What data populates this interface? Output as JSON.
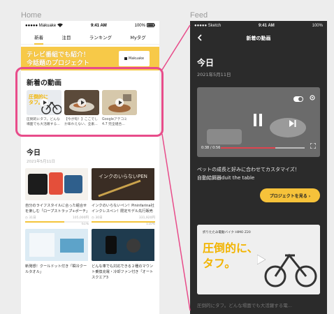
{
  "labels": {
    "home": "Home",
    "feed": "Feed"
  },
  "home": {
    "status": {
      "carrier": "●●●●● Makuake",
      "time": "9:41 AM",
      "battery": "100%"
    },
    "tabs": [
      "新着",
      "注目",
      "ランキング",
      "Myタグ"
    ],
    "banner": {
      "line1": "テレビ番組でも紹介！",
      "line2": "今話題のプロジェクト",
      "card": "Makuake"
    },
    "new_videos": {
      "title": "新着の動画",
      "items": [
        {
          "caption1": "圧倒的にタフ。どんな",
          "caption2": "場面でも大活躍する..."
        },
        {
          "caption1": "【今が旬！】ここでし",
          "caption2": "か味わえない、全素..."
        },
        {
          "caption1": "Googleアテコミ",
          "caption2": "4.7 完全組合..."
        }
      ]
    },
    "today": {
      "title": "今日",
      "date": "2021年5月11日",
      "cards": [
        {
          "title": "自分のライフスタイルに合った組合せを楽しむ「ロープストラップ+ポーチ」",
          "meta_left": "◷ 31日",
          "meta_right": "105,000円",
          "pct_label": "61%",
          "fill": 0.61
        },
        {
          "title": "インクのいらないペン！Pininfarina社インクレスペン！限定モデル先行販売",
          "meta_left": "◷ 30日",
          "meta_right": "331,920円",
          "pct_label": "110%",
          "fill": 1.0
        },
        {
          "title": "新発想！クールドット付き「瞬冷クールタオル」",
          "meta_left": "",
          "meta_right": "",
          "pct_label": "",
          "fill": 0
        },
        {
          "title": "どんな車でも対応できる２種のマウント乗換充電・冷却ファン付き「オートスクエア3",
          "meta_left": "",
          "meta_right": "",
          "pct_label": "",
          "fill": 0
        }
      ]
    }
  },
  "feed": {
    "status": {
      "carrier": "●●●●● Sketch",
      "time": "9:41 AM",
      "battery": "100%"
    },
    "nav_title": "新着の動画",
    "today": "今日",
    "date": "2021年5月11日",
    "video": {
      "time": "0:38 / 0:56"
    },
    "desc_line1": "ペットの成長と好みに合わせてカスタマイズ！",
    "desc_line2": "自動給餌器duit the table",
    "cta": "プロジェクトを見る ›",
    "second_video": {
      "badge": "折りたたみ電動バイク HIMO Z20",
      "big1": "圧倒的に、",
      "big2": "タフ。"
    },
    "second_caption": "圧倒的にタフ。どんな場面でも大活躍する電..."
  },
  "colors": {
    "accent": "#f6c23a",
    "highlight": "#e84c8a",
    "dark_bg": "#2b2b2b"
  }
}
